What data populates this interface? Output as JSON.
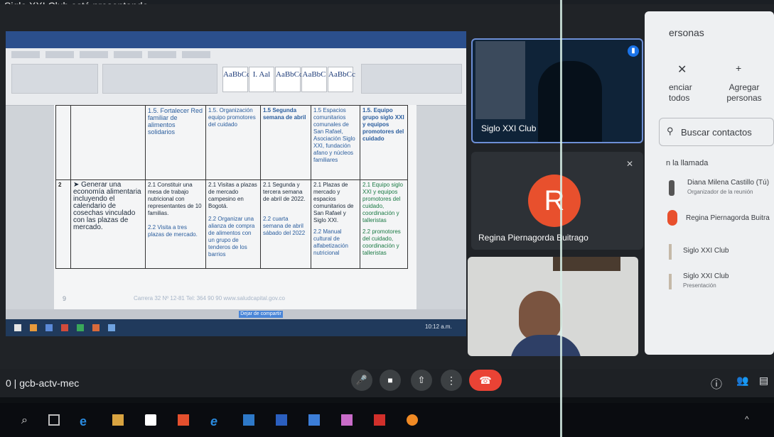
{
  "banner": {
    "text": "Siglo XXI Club está presentando"
  },
  "document": {
    "rows": [
      {
        "num": "",
        "objective": "",
        "action": "1.5. Fortalecer Red familiar de alimentos solidarios",
        "activity": "1.5. Organización equipo promotores del cuidado",
        "date": "1.5 Segunda semana de abril",
        "place": "1.5 Espacios comunitarios comunales de San Rafael, Asociación Siglo XXI, fundación afano y núcleos familiares",
        "responsible": "1.5. Equipo grupo siglo XXI y equipos promotores del cuidado"
      },
      {
        "num": "2",
        "objective": "➤ Generar una economía alimentaria incluyendo el calendario de cosechas vinculado con las plazas de mercado.",
        "action": "2.1 Constituir una mesa de trabajo nutricional con representantes de 10 familias.",
        "action2": "2.2 Visita a tres plazas de mercado.",
        "activity": "2.1 Visitas a plazas de mercado campesino en Bogotá.",
        "activity2": "2.2 Organizar una alianza de compra de alimentos con un grupo de tenderos de los barrios",
        "date": "2.1 Segunda y tercera semana de abril de 2022.",
        "date2": "2.2 cuarta semana de abril sábado del 2022",
        "place": "2.1 Plazas de mercado y espacios comunitarios de San Rafael y Siglo XXI.",
        "place2": "2.2 Manual cultural de alfabetización nutricional",
        "responsible": "2.1 Equipo siglo XXI y equipos promotores del cuidado, coordinación y talleristas",
        "responsible2": "2.2 promotores del cuidado, coordinación y talleristas"
      }
    ],
    "page_number": "9",
    "footer": "Carrera 32 Nº 12-81 Tel: 364 90 90  www.saludcapital.gov.co",
    "share_notice": "Dejar de compartir",
    "ribbon_styles": [
      "AaBbCcl",
      "I. Aal",
      "AaBbCc",
      "AaBbC",
      "AaBbCc"
    ],
    "clock": "10:12 a.m."
  },
  "tiles": [
    {
      "name": "Siglo XXI Club"
    },
    {
      "name": "Regina Piernagorda Buitrago",
      "initial": "R",
      "avatar_color": "#e8502d"
    },
    {
      "name": ""
    }
  ],
  "people_panel": {
    "title": "ersonas",
    "mute_all": "enciar todos",
    "add_people": "Agregar personas",
    "search_placeholder": "Buscar contactos",
    "section": "n la llamada",
    "participants": [
      {
        "name": "Diana Milena Castillo (Tú)",
        "role": "Organizador de la reunión"
      },
      {
        "name": "Regina Piernagorda Buitra",
        "role": ""
      },
      {
        "name": "Siglo XXI Club",
        "role": ""
      },
      {
        "name": "Siglo XXI Club",
        "role": "Presentación"
      }
    ]
  },
  "meeting": {
    "code": "gcb-actv-mec",
    "end_call_color": "#ea4335"
  }
}
